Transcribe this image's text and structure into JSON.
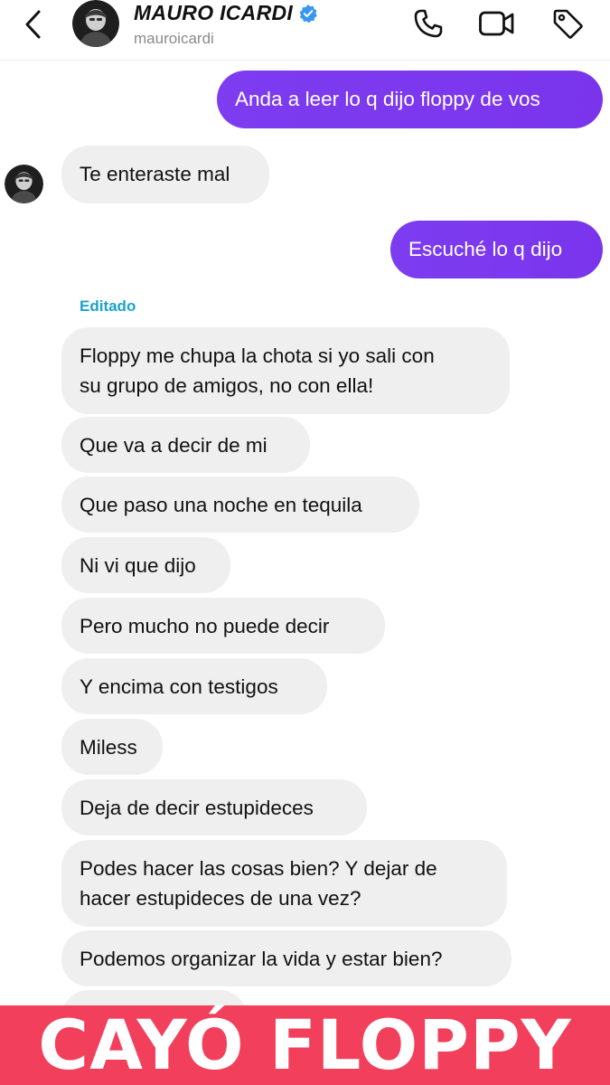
{
  "header": {
    "contact_name": "MAURO ICARDI",
    "handle": "mauroicardi",
    "icons": {
      "back": "chevron-left-icon",
      "verified": "verified-badge-icon",
      "call": "phone-icon",
      "video": "video-camera-icon",
      "tag": "tag-icon"
    }
  },
  "colors": {
    "outgoing_bubble": "#7a35ec",
    "incoming_bubble": "#efefef",
    "edited_label": "#1aa3c9",
    "banner": "#f2405c",
    "verified": "#3897f0"
  },
  "messages": [
    {
      "direction": "outgoing",
      "text": "Anda a leer lo q dijo floppy de vos"
    },
    {
      "direction": "incoming",
      "text": "Te enteraste mal"
    },
    {
      "direction": "outgoing",
      "text": "Escuché lo q dijo"
    },
    {
      "direction": "incoming",
      "status": "Editado",
      "text": "Floppy me chupa la chota si yo sali con\nsu grupo de amigos, no con ella!"
    },
    {
      "direction": "incoming",
      "text": "Que va a decir de mi"
    },
    {
      "direction": "incoming",
      "text": "Que paso una noche en tequila"
    },
    {
      "direction": "incoming",
      "text": "Ni vi que dijo"
    },
    {
      "direction": "incoming",
      "text": "Pero mucho no puede decir"
    },
    {
      "direction": "incoming",
      "text": "Y encima con testigos"
    },
    {
      "direction": "incoming",
      "text": "Miless"
    },
    {
      "direction": "incoming",
      "text": "Deja de decir estupideces"
    },
    {
      "direction": "incoming",
      "text": "Podes hacer las cosas bien? Y dejar de\nhacer estupideces de una vez?"
    },
    {
      "direction": "incoming",
      "text": "Podemos organizar la vida y estar bien?"
    }
  ],
  "banner": {
    "text": "CAYÓ FLOPPY"
  }
}
